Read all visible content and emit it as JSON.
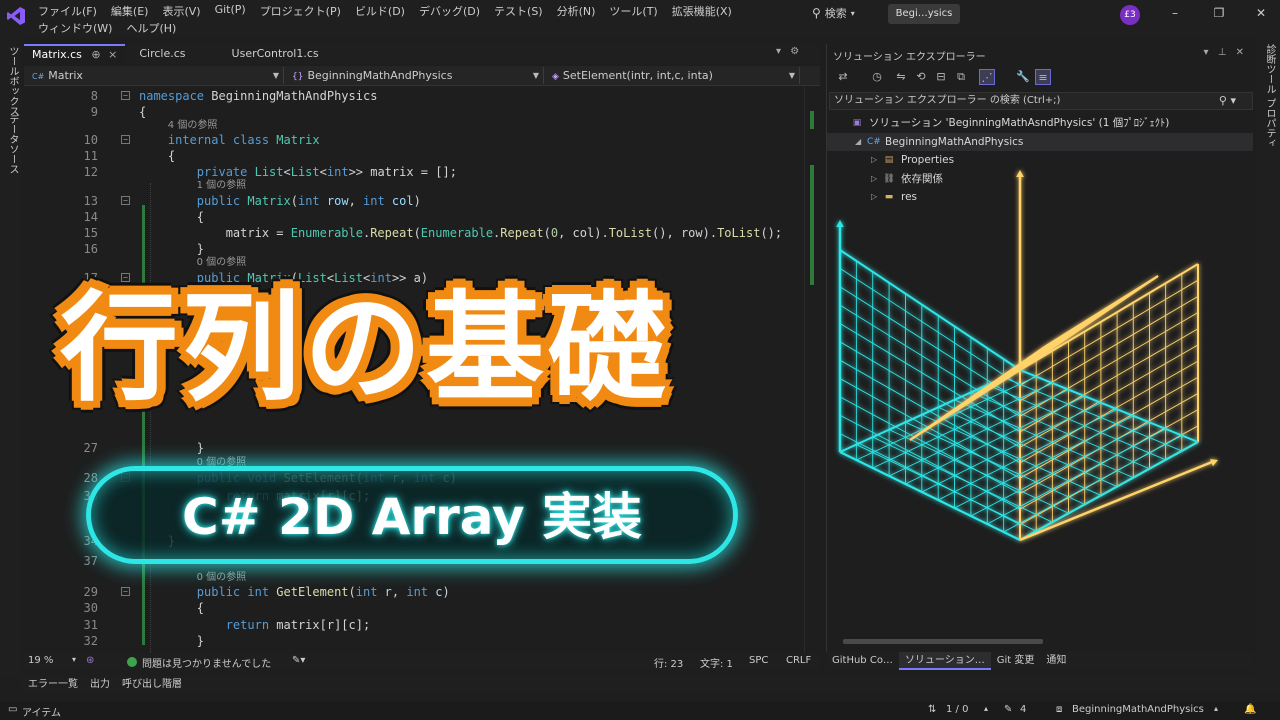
{
  "menu": [
    "ファイル(F)",
    "編集(E)",
    "表示(V)",
    "Git(P)",
    "プロジェクト(P)",
    "ビルド(D)",
    "デバッグ(D)",
    "テスト(S)",
    "分析(N)",
    "ツール(T)",
    "拡張機能(X)",
    "ウィンドウ(W)",
    "ヘルプ(H)"
  ],
  "search_label": "検索",
  "title_tab": "Begi…ysics",
  "avatar": "£3",
  "left_sidebar": [
    "ツールボックス",
    "データソース"
  ],
  "editor_tabs": [
    {
      "label": "Matrix.cs",
      "pin": "⊕",
      "close": "×"
    },
    {
      "label": "Circle.cs"
    },
    {
      "label": "UserControl1.cs"
    }
  ],
  "nav": {
    "file": "Matrix",
    "namespace": "BeginningMathAndPhysics",
    "member": "SetElement(intr, int,c, inta)"
  },
  "code_lines": [
    {
      "ln": "8",
      "fold": "⊟",
      "lens": "",
      "code": [
        [
          "kw",
          "namespace "
        ],
        [
          "",
          "BeginningMathAndPhysics"
        ]
      ]
    },
    {
      "ln": "9",
      "lens": "",
      "code": [
        [
          "",
          "{"
        ]
      ]
    },
    {
      "ln": "",
      "lens": "4 個の参照",
      "code": []
    },
    {
      "ln": "10",
      "fold": "⊟",
      "lens": "",
      "code": [
        [
          "",
          "    "
        ],
        [
          "kw",
          "internal class "
        ],
        [
          "ty",
          "Matrix"
        ]
      ]
    },
    {
      "ln": "11",
      "lens": "",
      "code": [
        [
          "",
          "    {"
        ]
      ]
    },
    {
      "ln": "12",
      "lens": "",
      "code": [
        [
          "",
          "        "
        ],
        [
          "kw",
          "private "
        ],
        [
          "ty",
          "List"
        ],
        [
          "",
          "<"
        ],
        [
          "ty",
          "List"
        ],
        [
          "",
          "<"
        ],
        [
          "kw",
          "int"
        ],
        [
          "",
          ">> matrix = [];"
        ]
      ]
    },
    {
      "ln": "",
      "lens": "1 個の参照",
      "code": []
    },
    {
      "ln": "13",
      "fold": "⊟",
      "lens": "",
      "code": [
        [
          "",
          "        "
        ],
        [
          "kw",
          "public "
        ],
        [
          "ty",
          "Matrix"
        ],
        [
          "",
          "("
        ],
        [
          "kw",
          "int "
        ],
        [
          "pa",
          "row"
        ],
        [
          "",
          ", "
        ],
        [
          "kw",
          "int "
        ],
        [
          "pa",
          "col"
        ],
        [
          "",
          ")"
        ]
      ]
    },
    {
      "ln": "14",
      "lens": "",
      "code": [
        [
          "",
          "        {"
        ]
      ]
    },
    {
      "ln": "15",
      "lens": "",
      "code": [
        [
          "",
          "            matrix = "
        ],
        [
          "ty",
          "Enumerable"
        ],
        [
          "",
          "."
        ],
        [
          "fn",
          "Repeat"
        ],
        [
          "",
          "("
        ],
        [
          "ty",
          "Enumerable"
        ],
        [
          "",
          "."
        ],
        [
          "fn",
          "Repeat"
        ],
        [
          "",
          "("
        ],
        [
          "nu",
          "0"
        ],
        [
          "",
          ", col)."
        ],
        [
          "fn",
          "ToList"
        ],
        [
          "",
          "(), row)."
        ],
        [
          "fn",
          "ToList"
        ],
        [
          "",
          "();"
        ]
      ]
    },
    {
      "ln": "16",
      "lens": "",
      "code": [
        [
          "",
          "        }"
        ]
      ]
    },
    {
      "ln": "",
      "lens": "0 個の参照",
      "code": []
    },
    {
      "ln": "17",
      "fold": "⊟",
      "lens": "",
      "code": [
        [
          "",
          "        "
        ],
        [
          "kw",
          "public "
        ],
        [
          "ty",
          "Matrix"
        ],
        [
          "",
          "("
        ],
        [
          "ty",
          "List"
        ],
        [
          "",
          "<"
        ],
        [
          "ty",
          "List"
        ],
        [
          "",
          "<"
        ],
        [
          "kw",
          "int"
        ],
        [
          "",
          ">> a)"
        ]
      ]
    },
    {
      "ln": "27",
      "lens": "",
      "code": [
        [
          "",
          "        }"
        ]
      ]
    },
    {
      "ln": "",
      "lens": "0 個の参照",
      "code": []
    },
    {
      "ln": "28",
      "fold": "⊟",
      "lens": "",
      "code": [
        [
          "",
          "        "
        ],
        [
          "kw",
          "public "
        ],
        [
          "kw",
          "void "
        ],
        [
          "fn",
          "SetElement"
        ],
        [
          "",
          "("
        ],
        [
          "kw",
          "int "
        ],
        [
          "pa",
          "r"
        ],
        [
          "",
          ", "
        ],
        [
          "kw",
          "int "
        ],
        [
          "pa",
          "c"
        ],
        [
          "",
          ")"
        ]
      ]
    },
    {
      "ln": "33",
      "lens": "",
      "code": [
        [
          "",
          "            "
        ],
        [
          "kw",
          "return "
        ],
        [
          "",
          "matrix[r][c];"
        ]
      ]
    },
    {
      "ln": "34",
      "lens": "",
      "code": [
        [
          "",
          "    }"
        ]
      ]
    },
    {
      "ln": "37",
      "lens": "",
      "code": []
    },
    {
      "ln": "",
      "lens": "0 個の参照",
      "code": []
    },
    {
      "ln": "29",
      "fold": "⊟",
      "lens": "",
      "code": [
        [
          "",
          "        "
        ],
        [
          "kw",
          "public "
        ],
        [
          "kw",
          "int "
        ],
        [
          "fn",
          "GetElement"
        ],
        [
          "",
          "("
        ],
        [
          "kw",
          "int "
        ],
        [
          "pa",
          "r"
        ],
        [
          "",
          ", "
        ],
        [
          "kw",
          "int "
        ],
        [
          "pa",
          "c"
        ],
        [
          "",
          ")"
        ]
      ]
    },
    {
      "ln": "30",
      "lens": "",
      "code": [
        [
          "",
          "        {"
        ]
      ]
    },
    {
      "ln": "31",
      "lens": "",
      "code": [
        [
          "",
          "            "
        ],
        [
          "kw",
          "return "
        ],
        [
          "",
          "matrix[r][c];"
        ]
      ]
    },
    {
      "ln": "32",
      "lens": "",
      "code": [
        [
          "",
          "        }"
        ]
      ]
    }
  ],
  "editor_status": {
    "zoom": "19 %",
    "issues": "問題は見つかりませんでした",
    "line": "行: 23",
    "char": "文字: 1",
    "spc": "SPC",
    "crlf": "CRLF"
  },
  "solution_explorer": {
    "title": "ソリューション エクスプローラー",
    "search_placeholder": "ソリューション エクスプローラー の検索 (Ctrl+;)",
    "tree": [
      {
        "label": "ソリューション 'BeginningMathAsndPhysics' (1 個ﾌﾟﾛｼﾞｪｸﾄ)",
        "indent": 0,
        "arrow": "",
        "icon": "solution-icon"
      },
      {
        "label": "BeginningMathAndPhysics",
        "indent": 1,
        "arrow": "◢",
        "icon": "csharp-project-icon"
      },
      {
        "label": "Properties",
        "indent": 2,
        "arrow": "▷",
        "icon": "properties-icon"
      },
      {
        "label": "依存関係",
        "indent": 2,
        "arrow": "▷",
        "icon": "dependencies-icon"
      },
      {
        "label": "res",
        "indent": 2,
        "arrow": "▷",
        "icon": "folder-icon"
      }
    ]
  },
  "right_tabs": [
    "GitHub Co…",
    "ソリューション…",
    "Git 変更",
    "通知"
  ],
  "right_sidebar": [
    "診断ツール",
    "プロパティ"
  ],
  "bottom_tabs": [
    "エラー一覧",
    "出力",
    "呼び出し階層"
  ],
  "statusbar": {
    "left": "アイテム",
    "nav": "1 / 0",
    "edits": "4",
    "project": "BeginningMathAndPhysics"
  },
  "overlay": {
    "title": "行列の基礎",
    "subtitle": "C# 2D Array 実装"
  },
  "colors": {
    "accent": "#f08a12",
    "neon_cyan": "#2ee6e6",
    "neon_yellow": "#ffd36b",
    "vs_purple": "#7a2fc4"
  }
}
